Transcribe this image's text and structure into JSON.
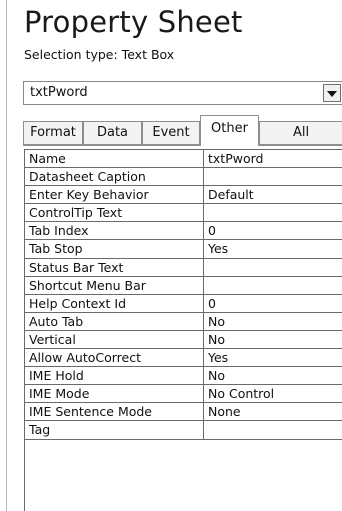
{
  "title": "Property Sheet",
  "selection_type": "Selection type:  Text Box",
  "selector": {
    "value": "txtPword"
  },
  "tabs": [
    {
      "label": "Format",
      "active": false
    },
    {
      "label": "Data",
      "active": false
    },
    {
      "label": "Event",
      "active": false
    },
    {
      "label": "Other",
      "active": true
    },
    {
      "label": "All",
      "active": false
    }
  ],
  "properties": [
    {
      "name": "Name",
      "value": "txtPword"
    },
    {
      "name": "Datasheet Caption",
      "value": ""
    },
    {
      "name": "Enter Key Behavior",
      "value": "Default"
    },
    {
      "name": "ControlTip Text",
      "value": ""
    },
    {
      "name": "Tab Index",
      "value": "0"
    },
    {
      "name": "Tab Stop",
      "value": "Yes"
    },
    {
      "name": "Status Bar Text",
      "value": ""
    },
    {
      "name": "Shortcut Menu Bar",
      "value": ""
    },
    {
      "name": "Help Context Id",
      "value": "0"
    },
    {
      "name": "Auto Tab",
      "value": "No"
    },
    {
      "name": "Vertical",
      "value": "No"
    },
    {
      "name": "Allow AutoCorrect",
      "value": "Yes"
    },
    {
      "name": "IME Hold",
      "value": "No"
    },
    {
      "name": "IME Mode",
      "value": "No Control"
    },
    {
      "name": "IME Sentence Mode",
      "value": "None"
    },
    {
      "name": "Tag",
      "value": ""
    }
  ]
}
